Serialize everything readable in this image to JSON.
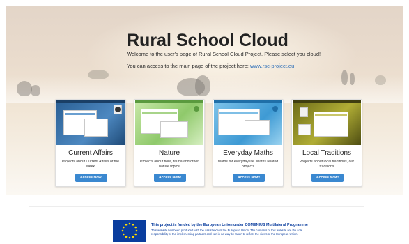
{
  "hero": {
    "title": "Rural School Cloud",
    "welcome": "Welcome to the user's page of Rural School Cloud Project. Please select you cloud!",
    "access_prefix": "You can access to the main page of the project here: ",
    "access_link": "www.rsc-project.eu"
  },
  "cards": [
    {
      "title": "Current Affairs",
      "description": "Projects about Current Affairs of the week",
      "button": "Access Now!",
      "theme": "#2f6fa8"
    },
    {
      "title": "Nature",
      "description": "Projects about flora, fauna and other nature topics",
      "button": "Access Now!",
      "theme": "#8cc86a"
    },
    {
      "title": "Everyday Maths",
      "description": "Maths for everyday life. Maths related projects",
      "button": "Access Now!",
      "theme": "#3e9ad4"
    },
    {
      "title": "Local Traditions",
      "description": "Projects about local traditions, our traditions",
      "button": "Access Now!",
      "theme": "#a7a32a"
    }
  ],
  "footer": {
    "funding_title": "This project is funded by the European Union under COMENIUS Multilateral Programme",
    "funding_text": "This website has been produced with the assistance of the European Union. The contents of this website are the sole responsibility of the implementing partners and can in no way be taken to reflect the views of the European Union."
  },
  "colors": {
    "button": "#3a88d0",
    "link": "#2d6fb8",
    "eu_blue": "#0a3d9e"
  }
}
